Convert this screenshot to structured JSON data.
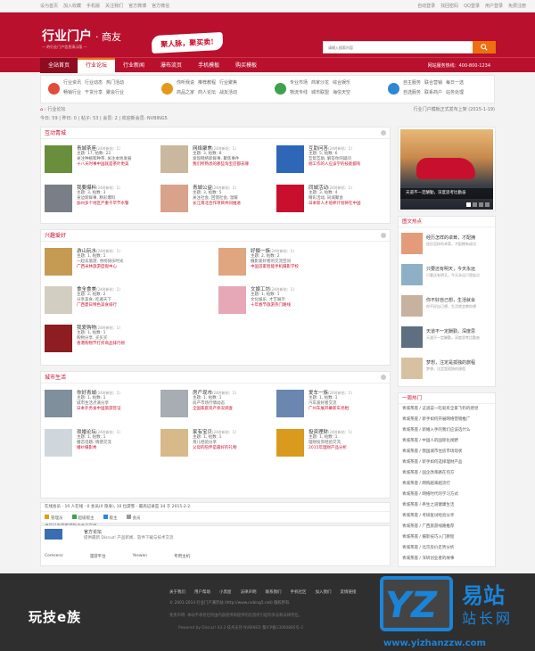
{
  "topbar": {
    "left": [
      "设为首页",
      "加入收藏",
      "手机版",
      "关注我们",
      "官方微博",
      "官方微信"
    ],
    "right": [
      "自动登录",
      "找回密码",
      "QQ登录",
      "用户登录",
      "免费注册"
    ]
  },
  "logo": {
    "title": "行业门户",
    "suffix": "· 商友",
    "tagline": "一 的行业门户信息演示版 一"
  },
  "slogan": "聚人脉，聚买卖!",
  "search": {
    "placeholder": "请输入搜索内容",
    "icon": "search-icon"
  },
  "nav": {
    "items": [
      "全站首页",
      "行业论坛",
      "行业新闻",
      "瀑布流页",
      "手机模板",
      "购买模板"
    ],
    "active": 1,
    "hotline": "网站服务热线：400-800-1234"
  },
  "subnav": [
    {
      "icon": "news-icon",
      "color": "#e24d3b",
      "links": [
        "行业资讯",
        "行业动态",
        "热门活动",
        "畅销行业",
        "干货分享",
        "聚会行业"
      ]
    },
    {
      "icon": "forum-icon",
      "color": "#e39a1c",
      "links": [
        "你听我说",
        "推荐教程",
        "行业聚焦",
        "商品之家",
        "商人论坛",
        "战友活动"
      ]
    },
    {
      "icon": "market-icon",
      "color": "#3ca34a",
      "links": [
        "专业市场",
        "商家沙龙",
        "综合娱乐",
        "物流专线",
        "城市联盟",
        "海信天空"
      ]
    },
    {
      "icon": "service-icon",
      "color": "#2f86d1",
      "links": [
        "自主服务",
        "联合营销",
        "每日一选",
        "自选服务",
        "联系商户",
        "站务处理"
      ]
    }
  ],
  "breadcrumb": {
    "label": "行业论坛",
    "right": "行业门户模板正式发布上架 (2015-1-19)"
  },
  "stats": {
    "text": "今日: 59 | 昨日: 0 | 帖子: 53 | 会员: 2 | 欢迎新会员: NVBING5"
  },
  "sections": [
    {
      "title": "互动青城",
      "forums": [
        {
          "name": "青城茶座",
          "tag": "(24时新帖：1)",
          "meta": "主题: 17, 帖数: 22",
          "desc": "关注种植和种茶, 关注本地发展",
          "last": "十八天时事中国就是茶叶更美",
          "color": "#6a8f3c"
        },
        {
          "name": "网络聚焦",
          "tag": "(24时新帖：1)",
          "meta": "主题: 3, 帖数: 8",
          "desc": "发现网络新鲜事, 聚焦事件",
          "last": "我们所熟悉的那些淘宝店都去哪",
          "color": "#c9b89d"
        },
        {
          "name": "互助问答",
          "tag": "(24时新帖：1)",
          "meta": "主题: 5, 帖数: 6",
          "desc": "互帮互助, 解答你的疑问",
          "last": "刚工作的人应该学的技能都有",
          "color": "#2f67b8"
        },
        {
          "name": "我要爆料",
          "tag": "(24时新帖：1)",
          "meta": "主题: 3, 帖数: 3",
          "desc": "身边新鲜事, 精彩爆料",
          "last": "加州多个地区严重干旱节水警",
          "color": "#7a7e86"
        },
        {
          "name": "青城公益",
          "tag": "(24时新帖：1)",
          "meta": "主题: 3, 帖数: 5",
          "desc": "关注社会, 回馈社会, 温暖",
          "last": "长江南北合作项目共同推进",
          "color": "#d9a28b"
        },
        {
          "name": "同城活动",
          "tag": "(24时新帖：1)",
          "meta": "主题: 3, 帖数: 4",
          "desc": "精彩活动, 同城聚会",
          "last": "日本新人才培养计划将在中国",
          "color": "#c8102e"
        }
      ]
    },
    {
      "title": "兴趣爱好",
      "forums": [
        {
          "name": "游山玩水",
          "tag": "(24时新帖：1)",
          "meta": "主题: 1, 帖数: 1",
          "desc": "一起去旅游, 寻找快乐时光",
          "last": "广西米林旅游度假中心",
          "color": "#c59a53"
        },
        {
          "name": "好摄一族",
          "tag": "(24时新帖：1)",
          "meta": "主题: 2, 帖数: 2",
          "desc": "摄影爱好者的交流空间",
          "last": "中国首家智能手机摄影学校",
          "color": "#e0a67f"
        },
        {
          "name": "食全食美",
          "tag": "(24时新帖：1)",
          "meta": "主题: 2, 帖数: 2",
          "desc": "分享美食, 吃遍天下",
          "last": "广西夏日特色美食排行",
          "color": "#d2cec1"
        },
        {
          "name": "文娱工坊",
          "tag": "(24时新帖：1)",
          "meta": "主题: 1, 帖数: 1",
          "desc": "文化娱乐, 才艺展示",
          "last": "十年春节旅游热门路线",
          "color": "#e6a8b7"
        },
        {
          "name": "我爱购物",
          "tag": "(24时新帖：1)",
          "meta": "主题: 1, 帖数: 1",
          "desc": "购物分享, 买买买",
          "last": "香港购物节打折商品排行榜",
          "color": "#8e1d22"
        }
      ]
    },
    {
      "title": "城市生活",
      "forums": [
        {
          "name": "你好青城",
          "tag": "(24时新帖：1)",
          "meta": "主题: 1, 帖数: 1",
          "desc": "城市生活点滴分享",
          "last": "日本外务省中国旅游签证",
          "color": "#7f8f9c"
        },
        {
          "name": "房产现市",
          "tag": "(24时新帖：1)",
          "meta": "主题: 1, 帖数: 1",
          "desc": "房产市场行情动态",
          "last": "全国家庭资产状况调查",
          "color": "#a7adb3"
        },
        {
          "name": "爱车一族",
          "tag": "(24时新帖：1)",
          "meta": "主题: 1, 帖数: 1",
          "desc": "汽车爱好者交流",
          "last": "广州车展开幕新车亮相",
          "color": "#6b87b0"
        },
        {
          "name": "琐婚论坛",
          "tag": "(24时新帖：1)",
          "meta": "主题: 1, 帖数: 1",
          "desc": "婚恋话题, 情感交流",
          "last": "婚纱摄影秀",
          "color": "#cfd6dc"
        },
        {
          "name": "家有宝贝",
          "tag": "(24时新帖：1)",
          "meta": "主题: 1, 帖数: 1",
          "desc": "育儿经验分享",
          "last": "父母的陪伴是最好的礼物",
          "color": "#d7b98a"
        },
        {
          "name": "投资理财",
          "tag": "(24时新帖：1)",
          "meta": "主题: 1, 帖数: 1",
          "desc": "理财投资经验交流",
          "last": "2015年理财产品分析",
          "color": "#d99a1e"
        }
      ]
    }
  ],
  "online": {
    "header": "在线会员 - 10 人在线 - 0 会员(0 隐身), 10 位游客 - 最高记录是 34 于 2015-2-2.",
    "legend": [
      {
        "label": "管理员",
        "color": "#e39a1c"
      },
      {
        "label": "超级版主",
        "color": "#3ca34a"
      },
      {
        "label": "版主",
        "color": "#2f86d1"
      },
      {
        "label": "会员",
        "color": "#999999"
      }
    ],
    "note": "当前只有游客或隐身会员在线"
  },
  "links": {
    "title": "官方论坛",
    "desc": "提供最新 Discuz! 产品新闻、软件下载与技术交流",
    "items": [
      "Comsenz",
      "漫游平台",
      "Yeswan",
      "专用主机"
    ]
  },
  "sidebar": {
    "banner": "天道不一定酬勤，深度思考比勤奋",
    "pic_title": "图文热点",
    "pics": [
      {
        "title": "经历怎样的卓茸，才配拥",
        "desc": "经历怎样的卓茸，才配拥有成功",
        "color": "#e49b7a"
      },
      {
        "title": "只要还有明天，今天永远",
        "desc": "只要还有明天，今天永远只是起点",
        "color": "#8db0c7"
      },
      {
        "title": "你不好自己想，生活就会",
        "desc": "你不好自己想，生活就会教你想",
        "color": "#c7b2a0"
      },
      {
        "title": "天道不一定酬勤，深度思",
        "desc": "天道不一定酬勤，深度思考比勤奋",
        "color": "#5e6f82"
      },
      {
        "title": "梦想，注定是孤独的旅程",
        "desc": "梦想，注定是孤独的旅程",
        "color": "#d8c1a0"
      }
    ],
    "hot_title": "一周热门",
    "hot": [
      "青城茶座 / 这道菜一吃就有全家飞钓的感觉",
      "青城茶座 / 新手如何开展网络营销推广",
      "青城茶座 / 新婚入手的我们应该选什么",
      "青城茶座 / 中国人的国际化视野",
      "青城茶座 / 我国城市住房市场现状",
      "青城茶座 / 新手如何选择理财产品",
      "青城茶座 / 国企改革路在何方",
      "青城茶座 / 网购越来越流行",
      "青城茶座 / 网络时代的学习方式",
      "青城茶座 / 养生之道健康生活",
      "青城茶座 / 考研复试经验分享",
      "青城茶座 / 广西旅游线路推荐",
      "青城茶座 / 摄影技巧入门教程",
      "青城茶座 / 北京房价走势分析",
      "青城茶座 / 深圳创业者的故事"
    ]
  },
  "footer": {
    "links": [
      "关于我们",
      "用户帮助",
      "小黑屋",
      "法律声明",
      "联系我们",
      "手机社区",
      "加入我们",
      "友情链接"
    ],
    "copy": "© 2001-2014 行业门户演示站 (http://www.nvbing5.net) 版权所有.",
    "line2": "免责声明: 本站不承担任何由内容提供商提供的信息所引起的争议和法律责任。",
    "line3": "Powered by Discuz! X3.2 技术支持 NVBING5 蜀ICP备13000885号-2",
    "logo": "玩技e族"
  },
  "watermark": {
    "box": "YZ",
    "cn1": "易站",
    "cn2": "站长网",
    "url": "www.yizhanzzw.com"
  }
}
